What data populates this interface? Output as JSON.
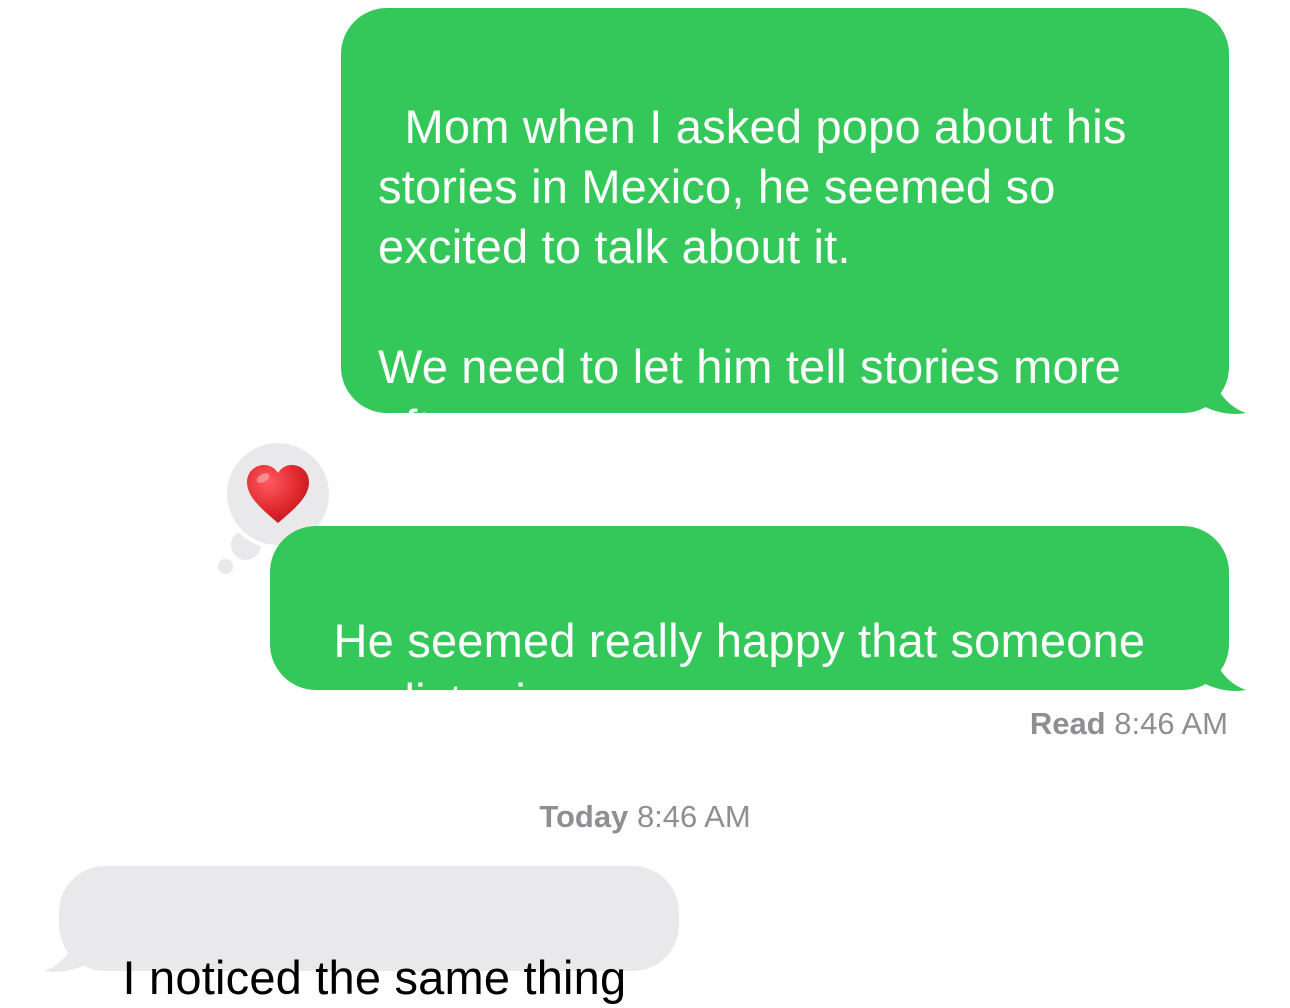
{
  "conversation": {
    "messages": [
      {
        "direction": "sent",
        "text": "Mom when I asked popo about his stories in Mexico, he seemed so excited to talk about it.\n\nWe need to let him tell stories more often"
      },
      {
        "direction": "sent",
        "text": "He seemed really happy that someone was listening",
        "reaction": {
          "icon": "heart-icon"
        }
      },
      {
        "direction": "received",
        "text": "I noticed the same thing"
      }
    ],
    "read_receipt": {
      "label": "Read",
      "time": "8:46 AM"
    },
    "timestamp": {
      "day": "Today",
      "time": "8:46 AM"
    }
  },
  "colors": {
    "sent_bubble": "#34c759",
    "received_bubble": "#e9e9eb",
    "heart": "#e0282e",
    "status_text": "#8e8e93"
  }
}
